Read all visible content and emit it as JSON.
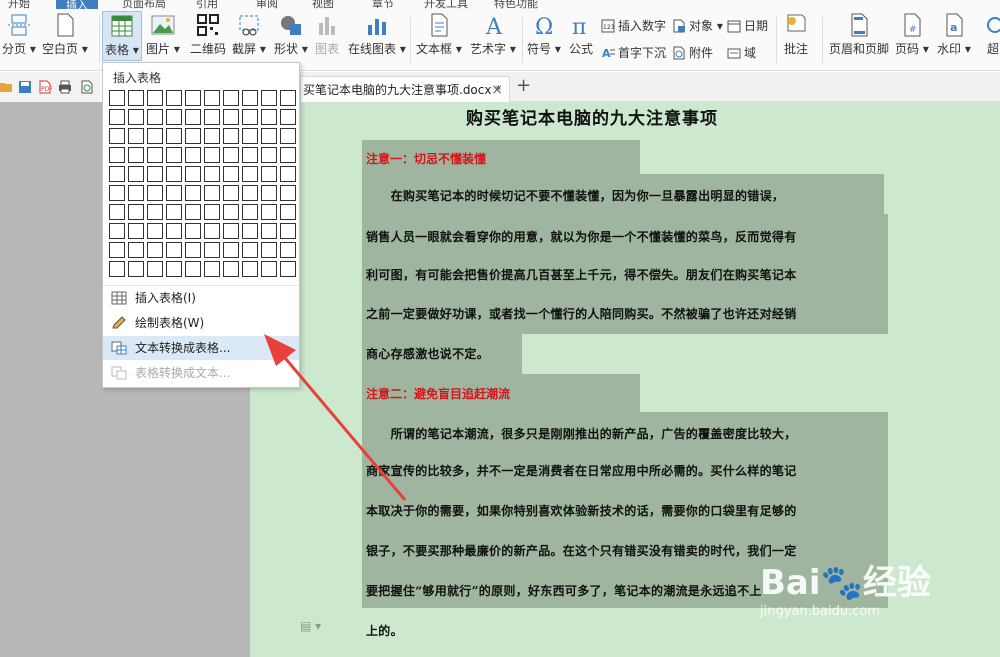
{
  "tabs": [
    "开始",
    "插入",
    "页面布局",
    "引用",
    "审阅",
    "视图",
    "章节",
    "开发工具",
    "特色功能"
  ],
  "ribbon": {
    "page_break": "分页",
    "blank_page": "空白页",
    "table": "表格",
    "picture": "图片",
    "qrcode": "二维码",
    "screenshot": "截屏",
    "shape": "形状",
    "chart": "图表",
    "online_chart": "在线图表",
    "textbox": "文本框",
    "wordart": "艺术字",
    "symbol": "符号",
    "formula": "公式",
    "insert_number": "插入数字",
    "object": "对象",
    "date": "日期",
    "drop_cap": "首字下沉",
    "attachment": "附件",
    "field": "域",
    "comment": "批注",
    "header_footer": "页眉和页脚",
    "page_number": "页码",
    "watermark": "水印",
    "hyperlink": "超"
  },
  "document": {
    "tab_title": "买笔记本电脑的九大注意事项.docx *",
    "close": "×",
    "new_tab": "+",
    "title": "购买笔记本电脑的九大注意事项",
    "heading1": "注意一：切忌不懂装懂",
    "para1": [
      "　　在购买笔记本的时候切记不要不懂装懂，因为你一旦暴露出明显的错误，",
      "销售人员一眼就会看穿你的用意，就以为你是一个不懂装懂的菜鸟，反而觉得有",
      "利可图，有可能会把售价提高几百甚至上千元，得不偿失。朋友们在购买笔记本",
      "之前一定要做好功课，或者找一个懂行的人陪同购买。不然被骗了也许还对经销",
      "商心存感激也说不定。"
    ],
    "heading2": "注意二：避免盲目追赶潮流",
    "para2": [
      "　　所谓的笔记本潮流，很多只是刚刚推出的新产品，广告的覆盖密度比较大，",
      "商家宣传的比较多，并不一定是消费者在日常应用中所必需的。买什么样的笔记",
      "本取决于你的需要，如果你特别喜欢体验新技术的话，需要你的口袋里有足够的",
      "银子，不要买那种最廉价的新产品。在这个只有错买没有错卖的时代，我们一定",
      "要把握住“够用就行”的原则，好东西可多了，笔记本的潮流是永远追不上",
      "上的。"
    ]
  },
  "menu": {
    "header": "插入表格",
    "insert_table": "插入表格(I)",
    "draw_table": "绘制表格(W)",
    "text_to_table": "文本转换成表格...",
    "table_to_text": "表格转换成文本..."
  },
  "watermark": {
    "logo": "Bai🐾经验",
    "url": "jingyan.baidu.com"
  },
  "colors": {
    "accent": "#3d7fc1",
    "page_bg": "#cce8cf",
    "highlight": "#9fb59f",
    "heading_red": "#d4161a",
    "arrow_red": "#e8403a"
  }
}
